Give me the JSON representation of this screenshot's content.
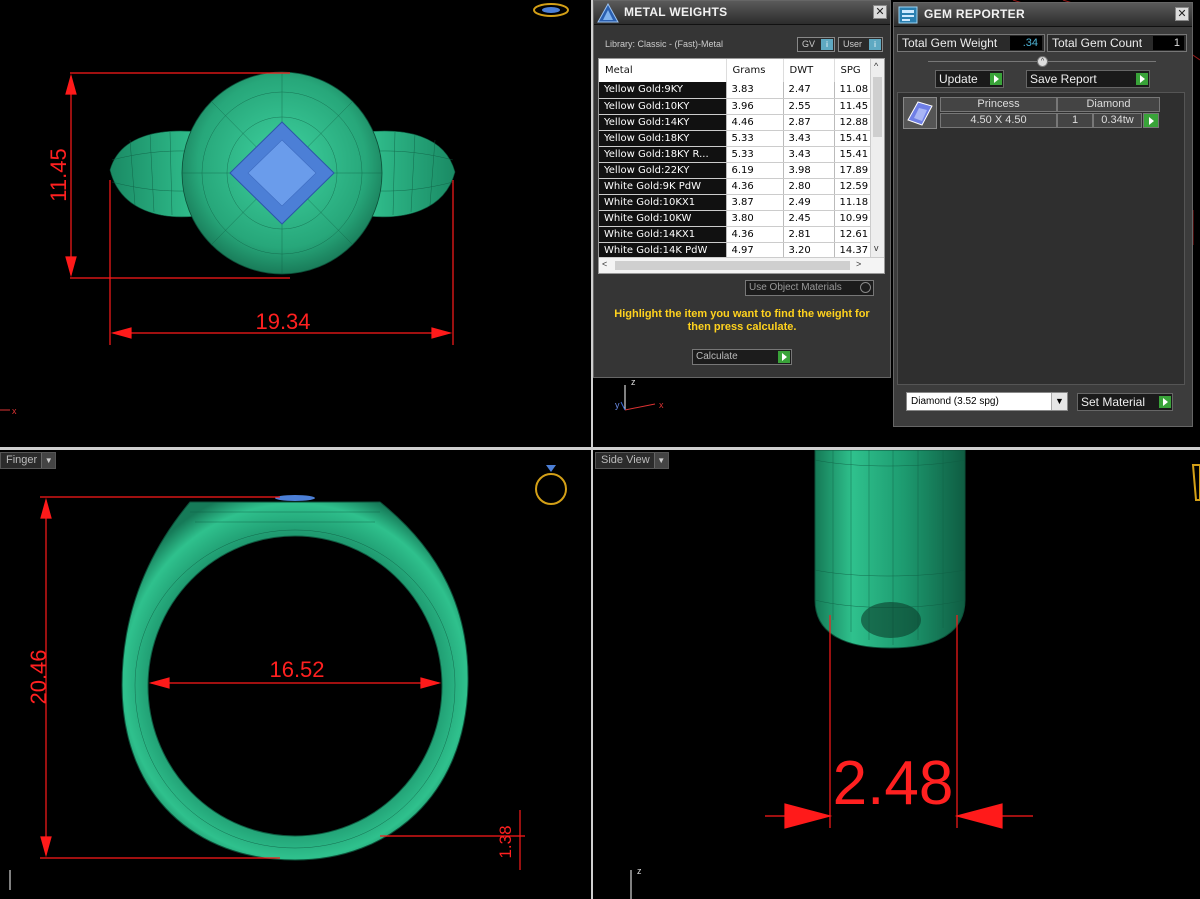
{
  "viewports": {
    "top": {
      "dim_width": "19.34",
      "dim_height": "11.45"
    },
    "bottom_left": {
      "label": "Finger",
      "dim_height": "20.46",
      "dim_inner": "16.52",
      "dim_shank": "1.38"
    },
    "bottom_right": {
      "label": "Side View",
      "dim_width": "2.48"
    },
    "axis_labels": {
      "x": "x",
      "y": "y",
      "z": "z"
    }
  },
  "metal_weights": {
    "title": "METAL WEIGHTS",
    "library": "Library: Classic - (Fast)-Metal",
    "gv_label": "GV",
    "user_label": "User",
    "columns": [
      "Metal",
      "Grams",
      "DWT",
      "SPG"
    ],
    "rows": [
      [
        "Yellow Gold:9KY",
        "3.83",
        "2.47",
        "11.08"
      ],
      [
        "Yellow Gold:10KY",
        "3.96",
        "2.55",
        "11.45"
      ],
      [
        "Yellow Gold:14KY",
        "4.46",
        "2.87",
        "12.88"
      ],
      [
        "Yellow Gold:18KY",
        "5.33",
        "3.43",
        "15.41"
      ],
      [
        "Yellow Gold:18KY R...",
        "5.33",
        "3.43",
        "15.41"
      ],
      [
        "Yellow Gold:22KY",
        "6.19",
        "3.98",
        "17.89"
      ],
      [
        "White Gold:9K PdW",
        "4.36",
        "2.80",
        "12.59"
      ],
      [
        "White Gold:10KX1",
        "3.87",
        "2.49",
        "11.18"
      ],
      [
        "White Gold:10KW",
        "3.80",
        "2.45",
        "10.99"
      ],
      [
        "White Gold:14KX1",
        "4.36",
        "2.81",
        "12.61"
      ],
      [
        "White Gold:14K PdW",
        "4.97",
        "3.20",
        "14.37"
      ]
    ],
    "use_object_materials": "Use Object Materials",
    "instruction": "Highlight the item you want to find the weight for then press calculate.",
    "calculate_label": "Calculate"
  },
  "gem_reporter": {
    "title": "GEM REPORTER",
    "total_weight_label": "Total Gem Weight",
    "total_weight_value": ".34",
    "total_count_label": "Total Gem Count",
    "total_count_value": "1",
    "update_label": "Update",
    "save_report_label": "Save Report",
    "gem": {
      "shape": "Princess",
      "material": "Diamond",
      "size": "4.50 X 4.50",
      "count": "1",
      "weight": "0.34tw"
    },
    "material_select": "Diamond      (3.52 spg)",
    "set_material_label": "Set Material"
  },
  "colors": {
    "dimension": "#ff1a1a",
    "ring": "#2dbd8a",
    "gem": "#5b8fe0",
    "instruction": "#ffd21e"
  }
}
